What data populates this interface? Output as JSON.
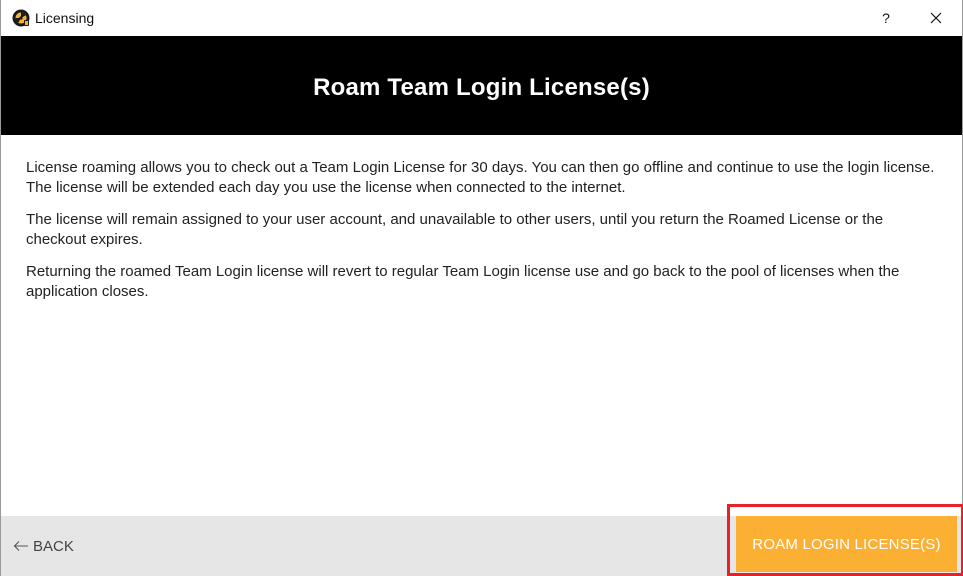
{
  "window": {
    "title": "Licensing",
    "help_label": "?",
    "icons": {
      "app": "licensing-app-icon",
      "close": "close-icon"
    }
  },
  "header": {
    "title": "Roam Team Login License(s)",
    "background": "#000000"
  },
  "content": {
    "paragraphs": [
      "License roaming allows you to check out a Team Login License for 30 days. You can then go offline and continue to use the login license. The license will be extended each day you use the license when connected to the internet.",
      "The license will remain assigned to your user account, and unavailable to other users, until you return the Roamed License or the checkout expires.",
      "Returning the roamed Team Login license will revert to regular Team Login license use and go back to the pool of licenses when the application closes."
    ]
  },
  "footer": {
    "back_label": "BACK",
    "back_icon": "arrow-left-icon",
    "primary_label": "ROAM LOGIN LICENSE(S)",
    "primary_color": "#fbb034",
    "highlight_color": "#e8202a"
  }
}
